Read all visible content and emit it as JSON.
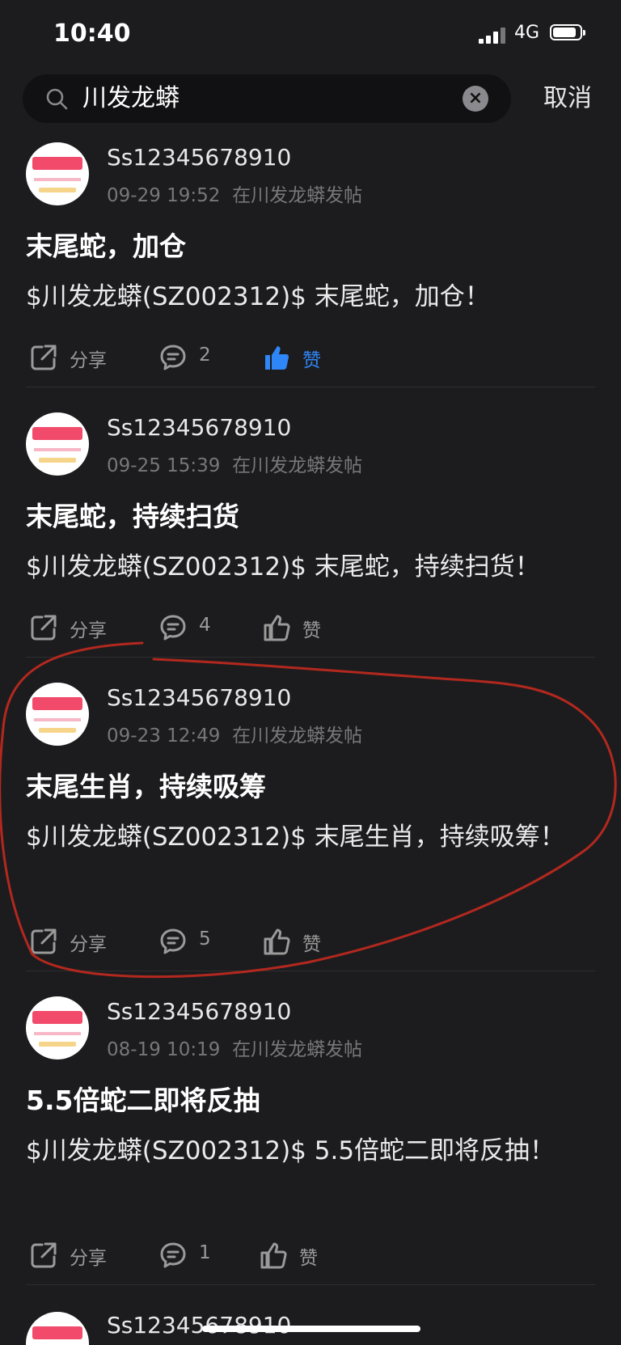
{
  "status_bar": {
    "time": "10:40",
    "network": "4G"
  },
  "search": {
    "query": "川发龙蟒",
    "cancel_label": "取消"
  },
  "posts": [
    {
      "username": "Ss12345678910",
      "date": "09-29 19:52",
      "location": "在川发龙蟒发帖",
      "title": "末尾蛇，加仓",
      "body": "$川发龙蟒(SZ002312)$ 末尾蛇，加仓！",
      "share_label": "分享",
      "comment_count": "2",
      "like_label": "赞",
      "liked": true
    },
    {
      "username": "Ss12345678910",
      "date": "09-25 15:39",
      "location": "在川发龙蟒发帖",
      "title": "末尾蛇，持续扫货",
      "body": "$川发龙蟒(SZ002312)$ 末尾蛇，持续扫货！",
      "share_label": "分享",
      "comment_count": "4",
      "like_label": "赞",
      "liked": false
    },
    {
      "username": "Ss12345678910",
      "date": "09-23 12:49",
      "location": "在川发龙蟒发帖",
      "title": "末尾生肖，持续吸筹",
      "body": "$川发龙蟒(SZ002312)$ 末尾生肖，持续吸筹！",
      "share_label": "分享",
      "comment_count": "5",
      "like_label": "赞",
      "liked": false
    },
    {
      "username": "Ss12345678910",
      "date": "08-19 10:19",
      "location": "在川发龙蟒发帖",
      "title": "5.5倍蛇二即将反抽",
      "body": "$川发龙蟒(SZ002312)$ 5.5倍蛇二即将反抽！",
      "share_label": "分享",
      "comment_count": "1",
      "like_label": "赞",
      "liked": false
    },
    {
      "username": "Ss12345678910"
    }
  ],
  "colors": {
    "background": "#1c1c1e",
    "accent_like": "#2f86f6",
    "annotation": "#b3281e"
  }
}
